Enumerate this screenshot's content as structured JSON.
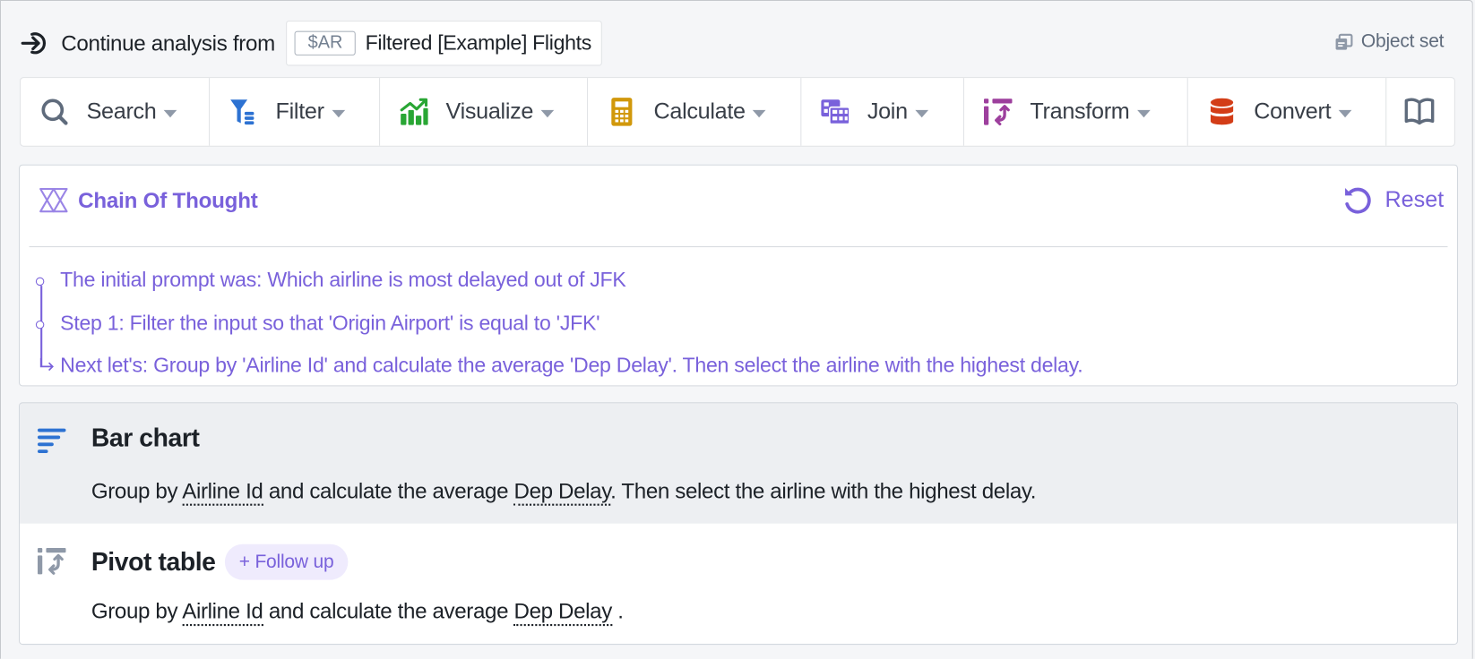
{
  "header": {
    "lead_text": "Continue analysis from",
    "source_tag": "$AR",
    "source_name": "Filtered [Example] Flights",
    "object_set_label": "Object set"
  },
  "toolbar": {
    "items": [
      {
        "label": "Search",
        "icon": "search-icon",
        "color": "#5f6b7c"
      },
      {
        "label": "Filter",
        "icon": "filter-icon",
        "color": "#2d72d2"
      },
      {
        "label": "Visualize",
        "icon": "chart-trend-icon",
        "color": "#29a634"
      },
      {
        "label": "Calculate",
        "icon": "calculator-icon",
        "color": "#d1980b"
      },
      {
        "label": "Join",
        "icon": "join-table-icon",
        "color": "#7961db"
      },
      {
        "label": "Transform",
        "icon": "transform-icon",
        "color": "#9d3f9d"
      },
      {
        "label": "Convert",
        "icon": "database-icon",
        "color": "#d33d17"
      }
    ],
    "docs_icon": "book-icon"
  },
  "chain_of_thought": {
    "title": "Chain Of Thought",
    "reset_label": "Reset",
    "accent": "#7961db",
    "steps": [
      "The initial prompt was: Which airline is most delayed out of JFK",
      "Step 1: Filter the input so that 'Origin Airport' is equal to 'JFK'",
      "Next let's: Group by 'Airline Id' and calculate the average 'Dep Delay'. Then select the airline with the highest delay."
    ]
  },
  "suggestions": [
    {
      "title": "Bar chart",
      "icon": "bar-chart-horizontal-icon",
      "desc_prefix": "Group by",
      "field1": "Airline Id",
      "desc_mid": "and calculate the average",
      "field2": "Dep Delay",
      "desc_suffix": ". Then select the airline with the highest delay.",
      "selected": true
    },
    {
      "title": "Pivot table",
      "icon": "pivot-table-icon",
      "badge": "+ Follow up",
      "desc_prefix": "Group by",
      "field1": "Airline Id",
      "desc_mid": "and calculate the average",
      "field2": "Dep Delay",
      "desc_suffix": ".",
      "selected": false
    }
  ]
}
